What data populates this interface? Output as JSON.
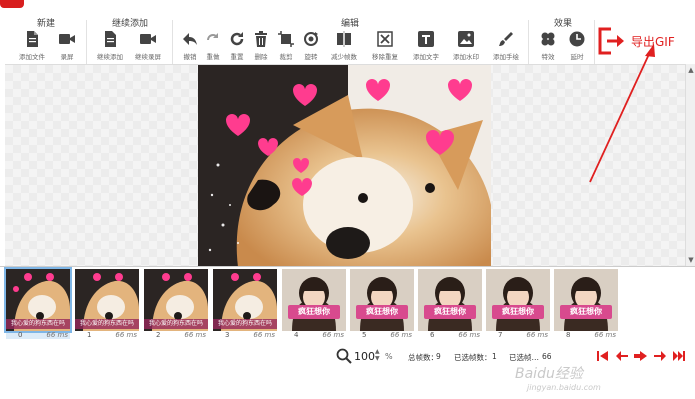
{
  "toolbar": {
    "groups": {
      "new": "新建",
      "continue_add": "继续添加",
      "edit": "编辑",
      "effects": "效果"
    },
    "buttons": {
      "add_file": "添加文件",
      "record": "录屏",
      "continue_add_file": "继续添加",
      "continue_record": "继续录屏",
      "undo": "撤销",
      "redo": "重做",
      "reset": "重置",
      "delete": "删除",
      "crop": "裁剪",
      "rotate": "旋转",
      "reduce_frames": "减少帧数",
      "remove_duplicates": "移除重复",
      "add_text": "添加文字",
      "add_watermark": "添加水印",
      "add_handwriting": "添加手绘",
      "effects": "特效",
      "delay": "延时"
    },
    "export_label": "导出GIF"
  },
  "frames": [
    {
      "index": "0",
      "duration": "66 ms",
      "caption": "我心爱的狗东西在吗"
    },
    {
      "index": "1",
      "duration": "66 ms",
      "caption": "我心爱的狗东西在吗"
    },
    {
      "index": "2",
      "duration": "66 ms",
      "caption": "我心爱的狗东西在吗"
    },
    {
      "index": "3",
      "duration": "66 ms",
      "caption": "我心爱的狗东西在吗"
    },
    {
      "index": "4",
      "duration": "66 ms",
      "caption": "疯狂想你"
    },
    {
      "index": "5",
      "duration": "66 ms",
      "caption": "疯狂想你"
    },
    {
      "index": "6",
      "duration": "66 ms",
      "caption": "疯狂想你"
    },
    {
      "index": "7",
      "duration": "66 ms",
      "caption": "疯狂想你"
    },
    {
      "index": "8",
      "duration": "66 ms",
      "caption": "疯狂想你"
    }
  ],
  "status": {
    "zoom": "100",
    "zoom_unit": "%",
    "total_frames_label": "总帧数：",
    "total_frames": "9",
    "selected_frames_label": "已选帧数：",
    "selected_frames": "1",
    "selected_time_label": "已选帧…",
    "selected_time": "66"
  },
  "watermark": {
    "main": "Baidu经验",
    "sub": "jingyan.baidu.com"
  },
  "colors": {
    "accent": "#e02020",
    "selection": "#7fb6e6",
    "icon": "#444444"
  }
}
